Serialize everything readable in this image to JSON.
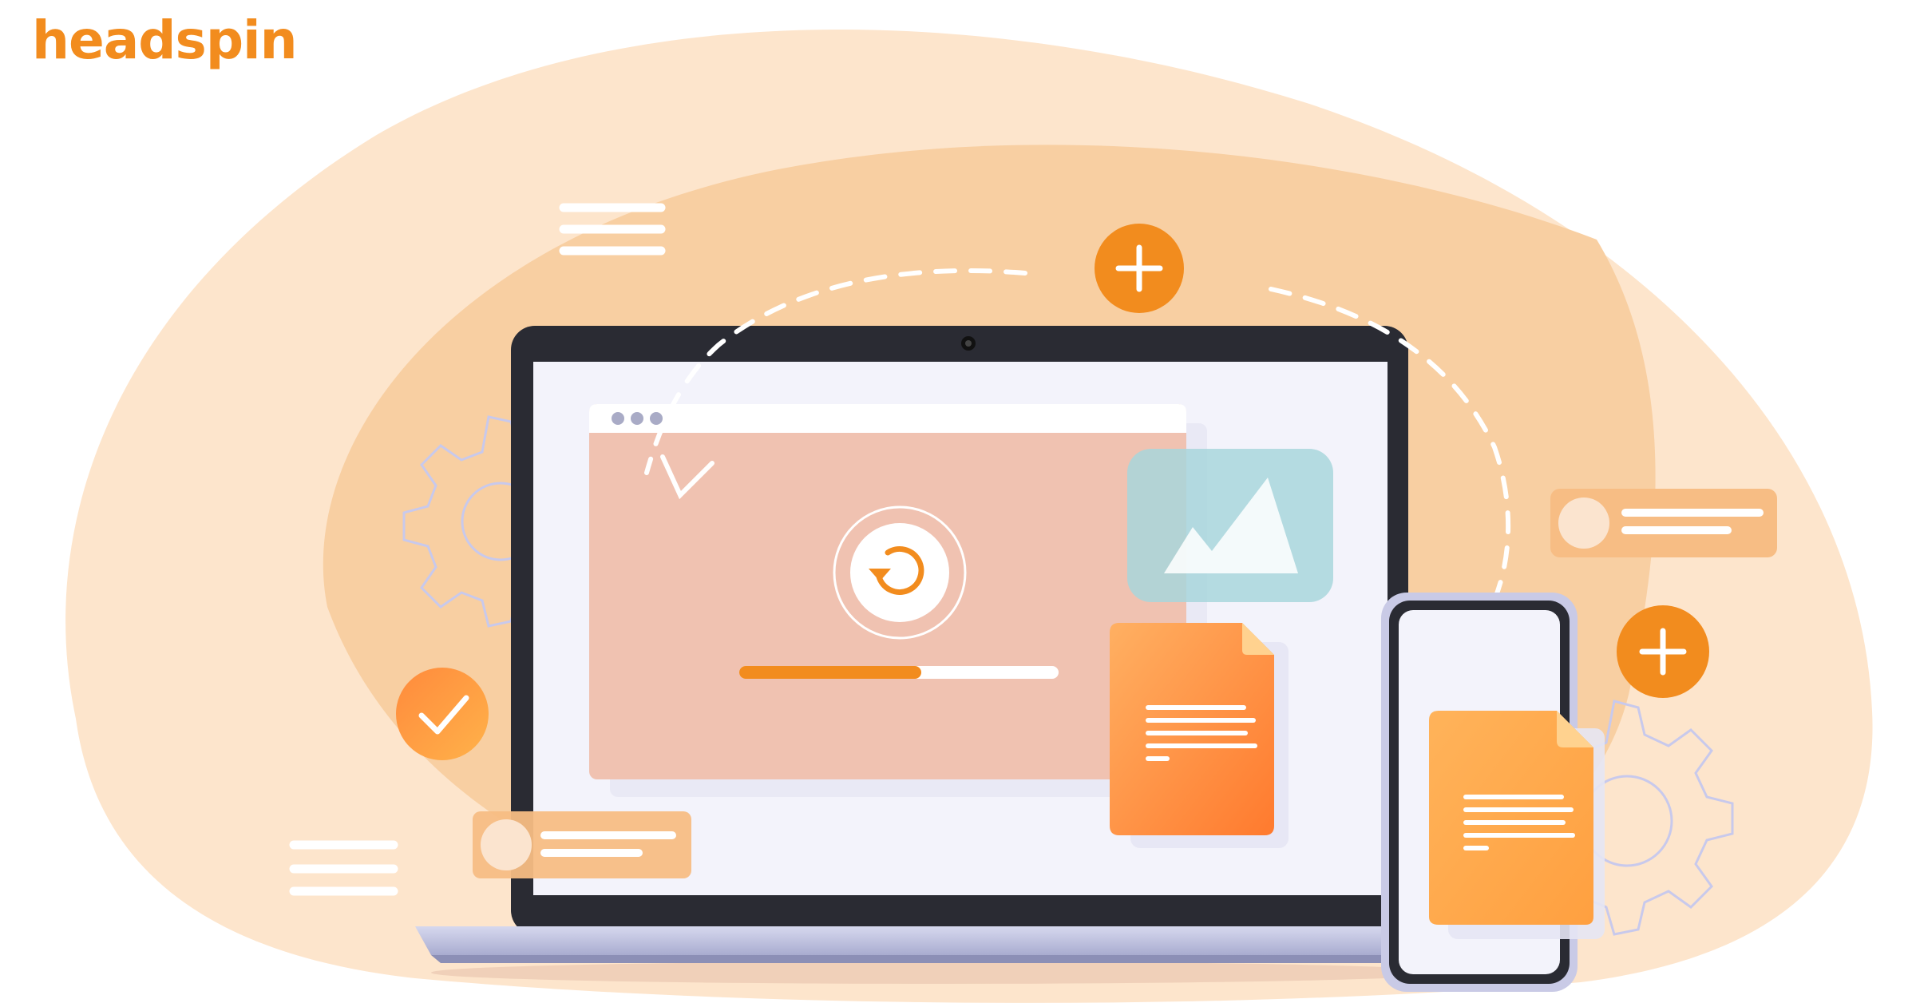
{
  "brand": {
    "name": "headspin"
  },
  "colors": {
    "accent": "#f28c1e",
    "background_blob_light": "#fde5cc",
    "background_blob_mid": "#f8cfa2",
    "laptop_frame": "#2a2b33",
    "screen": "#f3f3fb",
    "browser_panel": "#f0c2b1",
    "image_card": "#a8d6dc"
  },
  "icons": [
    "plus-icon",
    "check-icon",
    "refresh-icon",
    "image-icon",
    "document-icon",
    "gear-icon",
    "menu-lines-icon",
    "profile-card-icon"
  ],
  "illustration": {
    "progress_fraction": 0.57
  }
}
